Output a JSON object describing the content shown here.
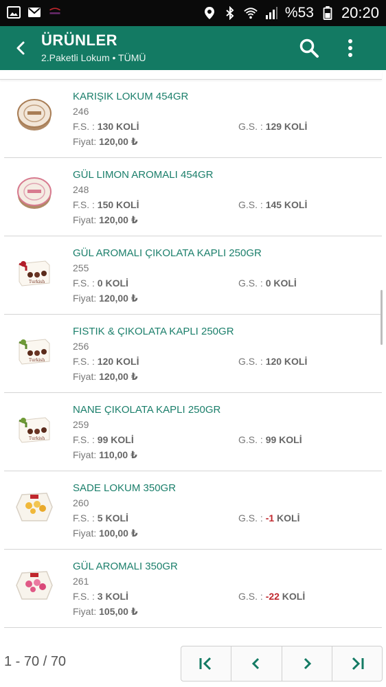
{
  "status_bar": {
    "battery_percent": "%53",
    "time": "20:20",
    "left_icons": [
      "image-icon",
      "mail-icon",
      "app-logo-icon"
    ],
    "right_icons": [
      "location-icon",
      "bluetooth-icon",
      "wifi-icon",
      "signal-icon",
      "battery-icon"
    ]
  },
  "app_bar": {
    "title": "ÜRÜNLER",
    "subtitle": "2.Paketli Lokum • TÜMÜ",
    "back_icon": "chevron-left-icon",
    "search_icon": "search-icon",
    "more_icon": "more-vertical-icon"
  },
  "labels": {
    "fs": "F.S.  : ",
    "gs": "G.S. : ",
    "unit": " KOLİ",
    "price": "Fiyat: "
  },
  "products": [
    {
      "name": "KARIŞIK LOKUM 454GR",
      "code": "246",
      "fs": "130",
      "gs": "129",
      "gs_negative": false,
      "price": "120,00 ₺",
      "image": "round-tin-brown"
    },
    {
      "name": "GÜL LIMON AROMALI 454GR",
      "code": "248",
      "fs": "150",
      "gs": "145",
      "gs_negative": false,
      "price": "120,00 ₺",
      "image": "round-tin-pink"
    },
    {
      "name": "GÜL AROMALI ÇIKOLATA KAPLI 250GR",
      "code": "255",
      "fs": "0",
      "gs": "0",
      "gs_negative": false,
      "price": "120,00 ₺",
      "image": "box-red-bow"
    },
    {
      "name": "FISTIK & ÇIKOLATA KAPLI 250GR",
      "code": "256",
      "fs": "120",
      "gs": "120",
      "gs_negative": false,
      "price": "120,00 ₺",
      "image": "box-green-bow"
    },
    {
      "name": "NANE ÇIKOLATA KAPLI 250GR",
      "code": "259",
      "fs": "99",
      "gs": "99",
      "gs_negative": false,
      "price": "110,00 ₺",
      "image": "box-green-bow"
    },
    {
      "name": "SADE LOKUM 350GR",
      "code": "260",
      "fs": "5",
      "gs": "-1",
      "gs_negative": true,
      "price": "100,00 ₺",
      "image": "hex-box-yellow"
    },
    {
      "name": "GÜL AROMALI 350GR",
      "code": "261",
      "fs": "3",
      "gs": "-22",
      "gs_negative": true,
      "price": "105,00 ₺",
      "image": "hex-box-pink"
    }
  ],
  "pagination": {
    "range_text": "1 - 70 / 70",
    "buttons": [
      "first-page-icon",
      "prev-page-icon",
      "next-page-icon",
      "last-page-icon"
    ]
  },
  "colors": {
    "app_bar": "#137a63",
    "product_name": "#1b7f6b",
    "negative": "#c0272d",
    "status_bar": "#0a0a0a"
  }
}
